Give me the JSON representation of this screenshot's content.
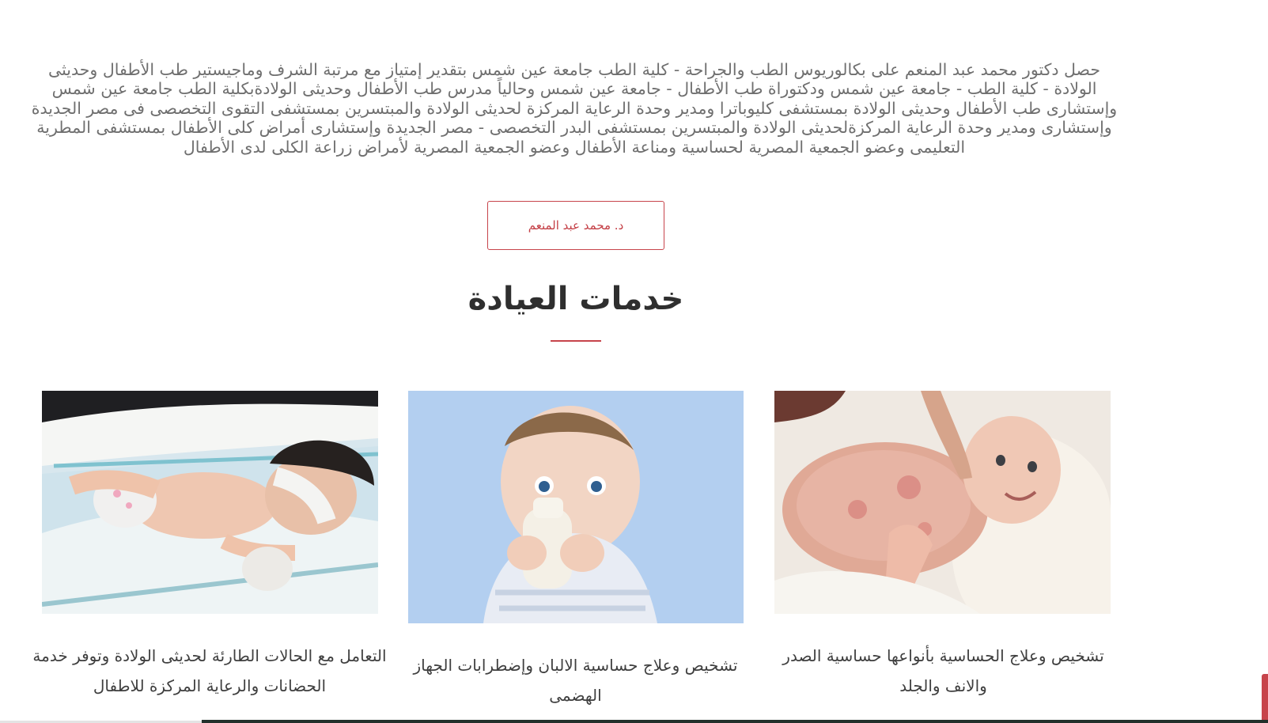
{
  "about": {
    "bio": "حصل دكتور محمد عبد المنعم على بكالوريوس الطب والجراحة - كلية الطب جامعة عين شمس بتقدير إمتياز مع مرتبة الشرف وماجيستير طب الأطفال وحديثى الولادة - كلية الطب - جامعة عين شمس ودكتوراة طب الأطفال - جامعة عين شمس وحالياً مدرس طب الأطفال وحديثى الولادةبكلية الطب جامعة عين شمس وإستشارى طب الأطفال وحديثى الولادة بمستشفى كليوباترا ومدير وحدة الرعاية المركزة لحديثى الولادة والمبتسرين بمستشفى التقوى التخصصى فى مصر الجديدة وإستشارى ومدير وحدة الرعاية المركزةلحديثى الولادة والمبتسرين بمستشفى البدر التخصصى - مصر الجديدة وإستشارى أمراض كلى الأطفال بمستشفى المطرية التعليمى وعضو الجمعية المصرية لحساسية ومناعة الأطفال وعضو الجمعية المصرية لأمراض زراعة الكلى لدى الأطفال",
    "doctor_button_label": "د. محمد عبد المنعم"
  },
  "services": {
    "title": "خدمات العيادة",
    "items": [
      {
        "text": "شخيص وعلاج الحساسية بأنواعها حساسية الصدر والانف والجلد",
        "display_text": "تشخيص وعلاج الحساسية بأنواعها حساسية الصدر والانف والجلد",
        "image": "baby-rash-photo"
      },
      {
        "text": "تشخيص وعلاج حساسية الالبان وإضطرابات الجهاز الهضمى",
        "image": "baby-bottle-photo"
      },
      {
        "text": "التعامل مع الحالات الطارئة لحديثى الولادة وتوفر خدمة الحضانات والرعاية المركزة للاطفال",
        "image": "newborn-incubator-photo"
      }
    ]
  },
  "colors": {
    "accent": "#c7444b",
    "body_text": "#6f6f6f",
    "heading": "#2f2f2f",
    "footer": "#22302b"
  }
}
